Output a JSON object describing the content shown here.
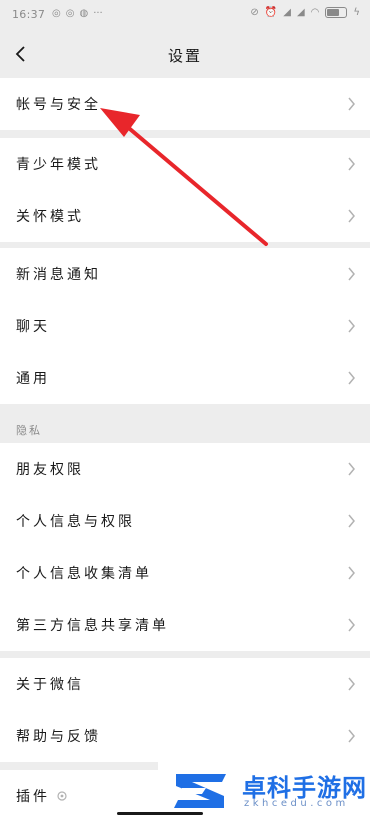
{
  "status_bar": {
    "time": "16:37",
    "left_icons": [
      "notification-icon",
      "notification-icon",
      "chat-bubble-icon"
    ],
    "more": "···",
    "right_icons": [
      "mute-icon",
      "alarm-icon",
      "hd-signal-icon",
      "signal-icon",
      "hd-signal-icon",
      "signal-icon",
      "wifi-icon",
      "battery-icon",
      "charging-icon"
    ]
  },
  "nav": {
    "title": "设置"
  },
  "groups": {
    "account": {
      "items": [
        {
          "label": "帐号与安全"
        }
      ]
    },
    "modes": {
      "items": [
        {
          "label": "青少年模式"
        },
        {
          "label": "关怀模式"
        }
      ]
    },
    "general": {
      "items": [
        {
          "label": "新消息通知"
        },
        {
          "label": "聊天"
        },
        {
          "label": "通用"
        }
      ]
    },
    "privacy": {
      "header": "隐私",
      "items": [
        {
          "label": "朋友权限"
        },
        {
          "label": "个人信息与权限"
        },
        {
          "label": "个人信息收集清单"
        },
        {
          "label": "第三方信息共享清单"
        }
      ]
    },
    "about": {
      "items": [
        {
          "label": "关于微信"
        },
        {
          "label": "帮助与反馈"
        }
      ]
    },
    "plugins": {
      "items": [
        {
          "label": "插件"
        }
      ]
    }
  },
  "watermark": {
    "title": "卓科手游网",
    "subtitle": "zkhcedu.com"
  },
  "colors": {
    "background": "#ededed",
    "cell": "#ffffff",
    "annotation_arrow": "#e8262b",
    "watermark_blue": "#1f6fe5"
  }
}
